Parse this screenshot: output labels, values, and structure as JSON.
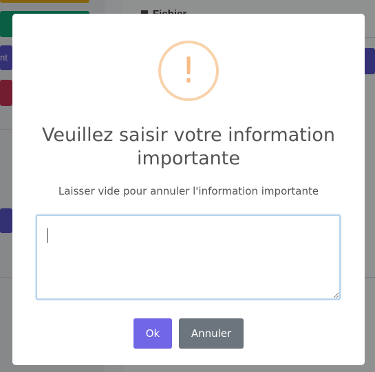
{
  "background": {
    "heading_text": "Fichier",
    "button_fragment": "nt"
  },
  "dialog": {
    "icon": "warning-exclamation-icon",
    "icon_glyph": "!",
    "title": "Veuillez saisir votre information importante",
    "text": "Laisser vide pour annuler l'information importante",
    "input": {
      "value": "",
      "placeholder": ""
    },
    "confirm_label": "Ok",
    "cancel_label": "Annuler"
  },
  "colors": {
    "confirm": "#7166e6",
    "cancel": "#6c757d",
    "warning": "#f8bb86",
    "input_focus_border": "#b4d3ee"
  }
}
